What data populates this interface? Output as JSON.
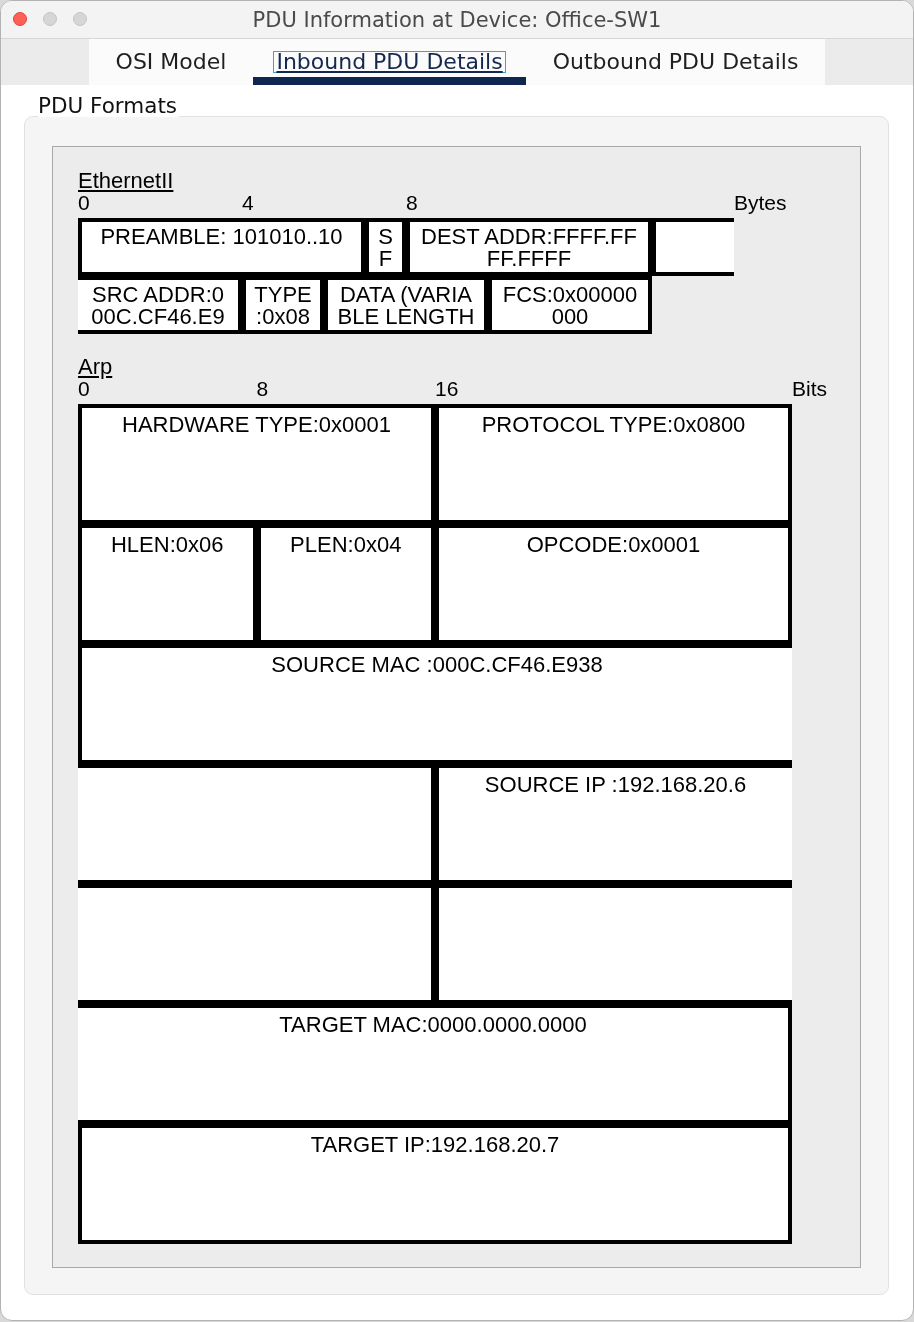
{
  "window": {
    "title": "PDU Information at Device: Office-SW1"
  },
  "tabs": [
    {
      "label": "OSI Model",
      "selected": false
    },
    {
      "label": "Inbound PDU Details",
      "selected": true
    },
    {
      "label": "Outbound PDU Details",
      "selected": false
    }
  ],
  "panel": {
    "title": "PDU Formats"
  },
  "sections": [
    {
      "title": "EthernetII",
      "ticks": [
        "0",
        "4",
        "8"
      ],
      "unit": "Bytes",
      "fields": [
        {
          "kind": "whole",
          "lines": [
            "PREAMBLE: 101010..10"
          ]
        },
        {
          "kind": "whole",
          "lines": [
            "S",
            "F"
          ]
        },
        {
          "kind": "whole",
          "lines": [
            "DEST ADDR:FFFF.FF",
            "FF.FFFF"
          ]
        },
        {
          "kind": "head"
        },
        {
          "kind": "tail",
          "lines": [
            "SRC ADDR:0",
            "00C.CF46.E9"
          ]
        },
        {
          "kind": "whole",
          "lines": [
            "TYPE",
            ":0x08"
          ]
        },
        {
          "kind": "whole",
          "lines": [
            "DATA (VARIA",
            "BLE LENGTH"
          ]
        },
        {
          "kind": "whole",
          "lines": [
            "FCS:0x00000",
            "000"
          ]
        }
      ]
    },
    {
      "title": "Arp",
      "ticks": [
        "0",
        "8",
        "16"
      ],
      "unit": "Bits",
      "fields": [
        {
          "kind": "whole",
          "lines": [
            "HARDWARE TYPE:0x0001"
          ]
        },
        {
          "kind": "whole",
          "lines": [
            "PROTOCOL TYPE:0x0800"
          ]
        },
        {
          "kind": "whole",
          "lines": [
            "HLEN:0x06"
          ]
        },
        {
          "kind": "whole",
          "lines": [
            "PLEN:0x04"
          ]
        },
        {
          "kind": "whole",
          "lines": [
            "OPCODE:0x0001"
          ]
        },
        {
          "kind": "head",
          "lines": [
            "SOURCE MAC :000C.CF46.E938"
          ]
        },
        {
          "kind": "tail"
        },
        {
          "kind": "head",
          "lines": [
            "SOURCE IP :192.168.20.6"
          ]
        },
        {
          "kind": "tail"
        },
        {
          "kind": "head"
        },
        {
          "kind": "tail",
          "lines": [
            "TARGET MAC:0000.0000.0000"
          ]
        },
        {
          "kind": "whole",
          "lines": [
            "TARGET IP:192.168.20.7"
          ]
        }
      ]
    }
  ]
}
